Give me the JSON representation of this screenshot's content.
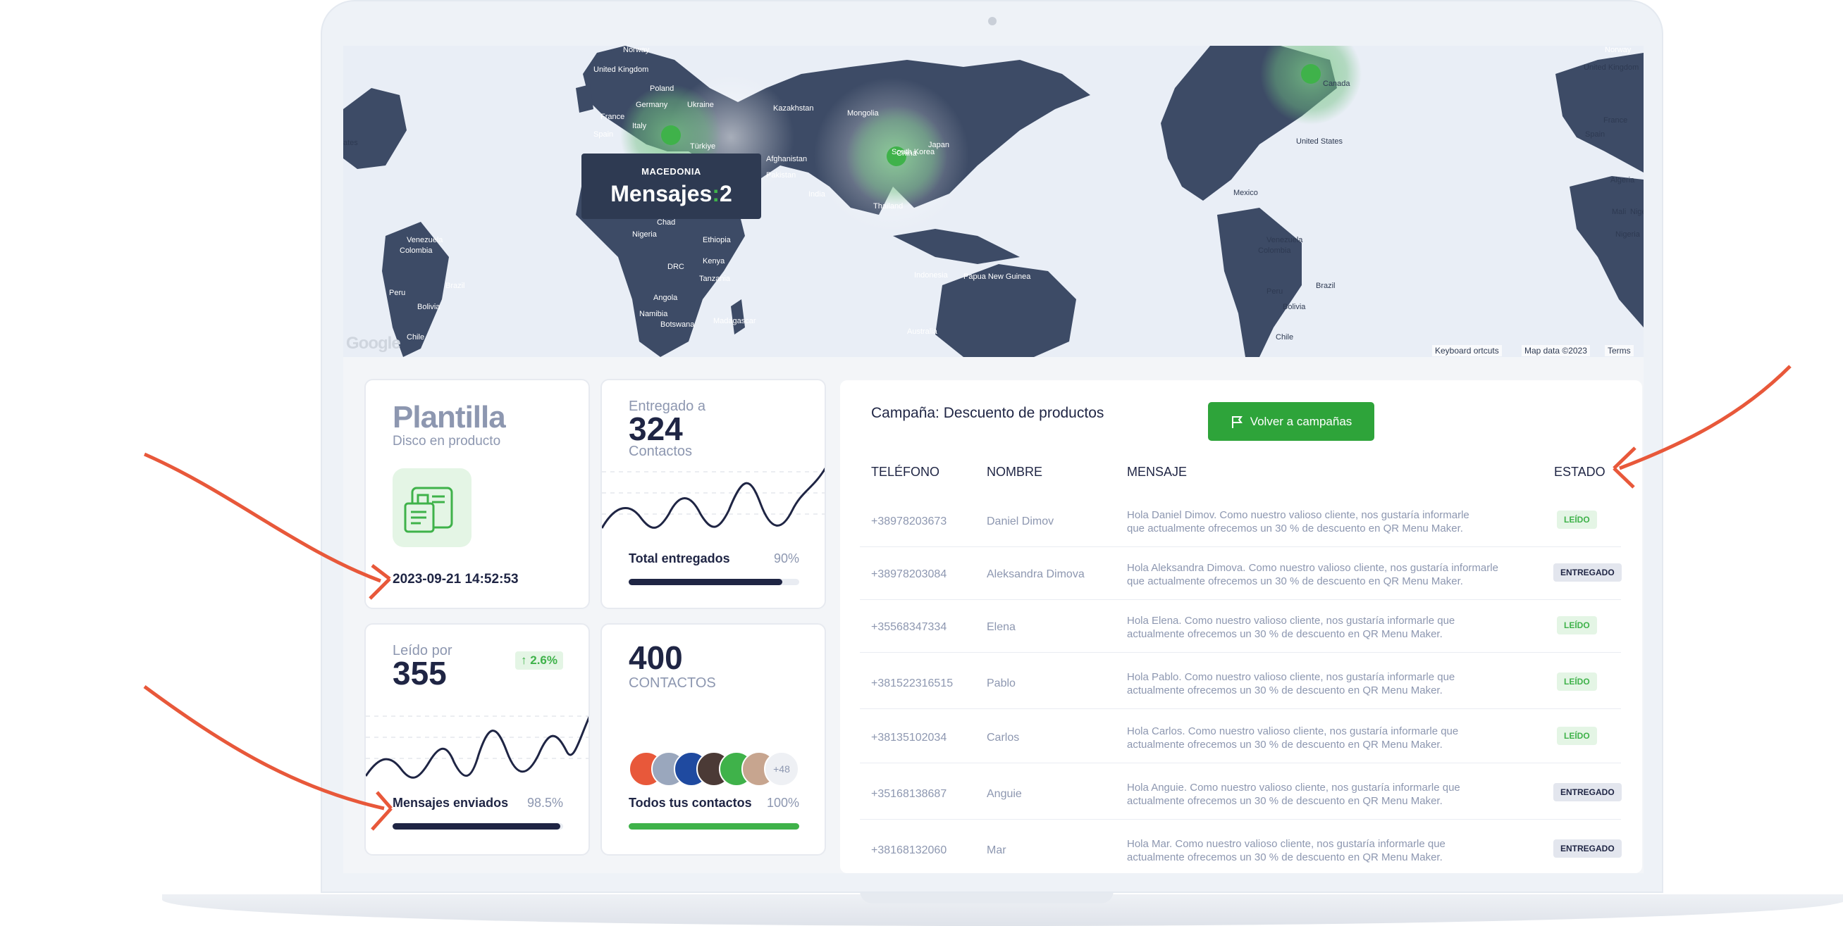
{
  "map": {
    "tooltip_country": "MACEDONIA",
    "tooltip_label": "Mensajes",
    "tooltip_value": "2",
    "google": "Google",
    "attribution": {
      "keyboard": "Keyboard",
      "shortcuts": "ortcuts",
      "mapdata": "Map data ©2023",
      "terms": "Terms"
    },
    "labels": [
      "Norway",
      "United Kingdom",
      "Poland",
      "Germany",
      "Ukraine",
      "France",
      "Italy",
      "Spain",
      "Türkiye",
      "Kazakhstan",
      "Mongolia",
      "Afghanistan",
      "Pakistan",
      "India",
      "China",
      "South Korea",
      "Japan",
      "Thailand",
      "Indonesia",
      "Papua New Guinea",
      "Australia",
      "Chad",
      "Nigeria",
      "Ethiopia",
      "Kenya",
      "DRC",
      "Tanzania",
      "Angola",
      "Namibia",
      "Botswana",
      "Madagascar",
      "Venezuela",
      "Colombia",
      "Peru",
      "Brazil",
      "Bolivia",
      "Chile",
      "United States",
      "Mexico",
      "Canada",
      "Norway",
      "United Kingdom",
      "France",
      "Spain",
      "Algeria",
      "Mali",
      "Niger",
      "Nigeria",
      "Venezuela",
      "Colombia",
      "Peru",
      "Brazil",
      "Bolivia",
      "Chile",
      "ates"
    ]
  },
  "template_card": {
    "title": "Plantilla",
    "subtitle": "Disco en producto",
    "datetime": "2023-09-21 14:52:53"
  },
  "delivered_card": {
    "label": "Entregado a",
    "value": "324",
    "unit": "Contactos",
    "bar_label": "Total entregados",
    "bar_percent": "90%",
    "bar_fraction": 0.9
  },
  "read_card": {
    "label": "Leído por",
    "value": "355",
    "change": "2.6%",
    "bar_label": "Mensajes enviados",
    "bar_percent": "98.5%",
    "bar_fraction": 0.985
  },
  "contacts_card": {
    "value": "400",
    "unit": "CONTACTOS",
    "more_count": "+48",
    "bar_label": "Todos tus contactos",
    "bar_percent": "100%",
    "bar_fraction": 1.0
  },
  "campaign": {
    "title": "Campaña: Descuento de productos",
    "back_button": "Volver a campañas",
    "columns": [
      "TELÉFONO",
      "NOMBRE",
      "MENSAJE",
      "ESTADO"
    ],
    "rows": [
      {
        "phone": "+38978203673",
        "name": "Daniel Dimov",
        "message1": "Hola Daniel Dimov. Como nuestro valioso cliente, nos gustaría informarle",
        "message2": "que actualmente ofrecemos un 30 % de descuento en QR Menu Maker.",
        "status": "LEÍDO"
      },
      {
        "phone": "+38978203084",
        "name": "Aleksandra Dimova",
        "message1": "Hola Aleksandra Dimova. Como nuestro valioso cliente, nos gustaría informarle",
        "message2": "que actualmente ofrecemos un 30 % de descuento en QR Menu Maker.",
        "status": "ENTREGADO"
      },
      {
        "phone": "+35568347334",
        "name": "Elena",
        "message1": "Hola Elena. Como nuestro valioso cliente, nos gustaría informarle que",
        "message2": "actualmente ofrecemos un 30 % de descuento en QR Menu Maker.",
        "status": "LEÍDO"
      },
      {
        "phone": "+381522316515",
        "name": "Pablo",
        "message1": "Hola Pablo. Como nuestro valioso cliente, nos gustaría informarle que",
        "message2": "actualmente ofrecemos un 30 % de descuento en QR Menu Maker.",
        "status": "LEÍDO"
      },
      {
        "phone": "+38135102034",
        "name": "Carlos",
        "message1": "Hola Carlos. Como nuestro valioso cliente, nos gustaría informarle que",
        "message2": "actualmente ofrecemos un 30 % de descuento en QR Menu Maker.",
        "status": "LEÍDO"
      },
      {
        "phone": "+35168138687",
        "name": "Anguie",
        "message1": "Hola Anguie. Como nuestro valioso cliente, nos gustaría informarle que",
        "message2": "actualmente ofrecemos un 30 % de descuento en QR Menu Maker.",
        "status": "ENTREGADO"
      },
      {
        "phone": "+38168132060",
        "name": "Mar",
        "message1": "Hola Mar. Como nuestro valioso cliente, nos gustaría informarle que",
        "message2": "actualmente ofrecemos un 30 % de descuento en QR Menu Maker.",
        "status": "ENTREGADO"
      }
    ]
  },
  "colors": {
    "accent_green": "#2ea43a",
    "navy": "#1f2544",
    "map_land": "#3d4b66",
    "map_water": "#e9eef6",
    "arrow": "#e8583a"
  }
}
